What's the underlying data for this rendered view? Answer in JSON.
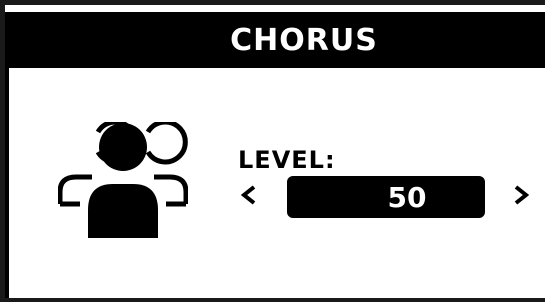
{
  "header": {
    "title": "CHORUS"
  },
  "effect": {
    "icon": "people-group-icon",
    "parameter_label": "LEVEL:",
    "value": "50",
    "decrease_icon": "chevron-left-icon",
    "increase_icon": "chevron-right-icon"
  },
  "colors": {
    "background": "#ffffff",
    "foreground": "#000000",
    "header_text": "#ffffff"
  }
}
